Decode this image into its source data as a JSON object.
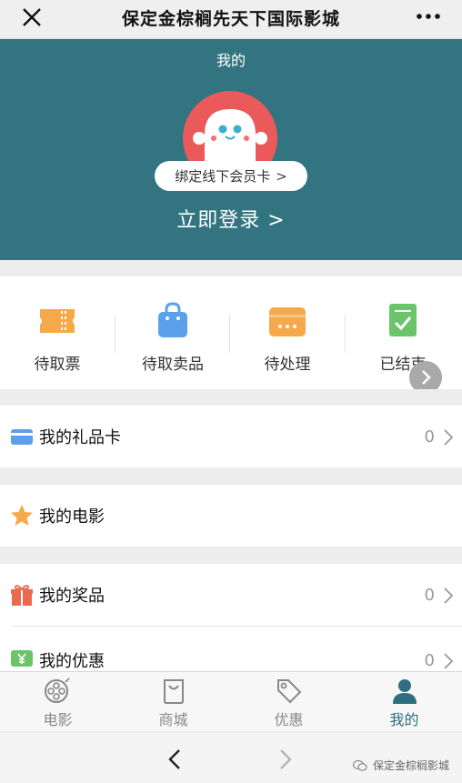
{
  "header": {
    "title": "保定金棕榈先天下国际影城",
    "close_icon": "close-icon",
    "more_icon": "more-dots-icon"
  },
  "profile": {
    "title": "我的",
    "bind_card": "绑定线下会员卡",
    "bind_card_chevron": ">",
    "login": "立即登录 >",
    "bg_color": "#327580",
    "avatar_color": "#ea5a5a"
  },
  "orders": [
    {
      "label": "待取票",
      "icon": "ticket-icon",
      "color": "#f5a94a"
    },
    {
      "label": "待取卖品",
      "icon": "shopping-bag-icon",
      "color": "#5aa0ea"
    },
    {
      "label": "待处理",
      "icon": "card-pending-icon",
      "color": "#f5a94a"
    },
    {
      "label": "已结束",
      "icon": "checklist-icon",
      "color": "#6cc46a"
    }
  ],
  "menu": {
    "gift_card": {
      "label": "我的礼品卡",
      "count": "0",
      "icon": "credit-card-icon"
    },
    "movies": {
      "label": "我的电影",
      "icon": "star-icon"
    },
    "prizes": {
      "label": "我的奖品",
      "count": "0",
      "icon": "gift-icon"
    },
    "coupons": {
      "label": "我的优惠",
      "count": "0",
      "icon": "yen-coupon-icon"
    }
  },
  "tabbar": [
    {
      "label": "电影",
      "icon": "film-reel-icon",
      "active": false
    },
    {
      "label": "商城",
      "icon": "shopping-bag-icon",
      "active": false
    },
    {
      "label": "优惠",
      "icon": "tag-icon",
      "active": false
    },
    {
      "label": "我的",
      "icon": "user-icon",
      "active": true
    }
  ],
  "navbar": {
    "watermark": "保定金棕榈影城",
    "back_icon": "back-arrow-icon",
    "forward_icon": "forward-arrow-icon"
  }
}
